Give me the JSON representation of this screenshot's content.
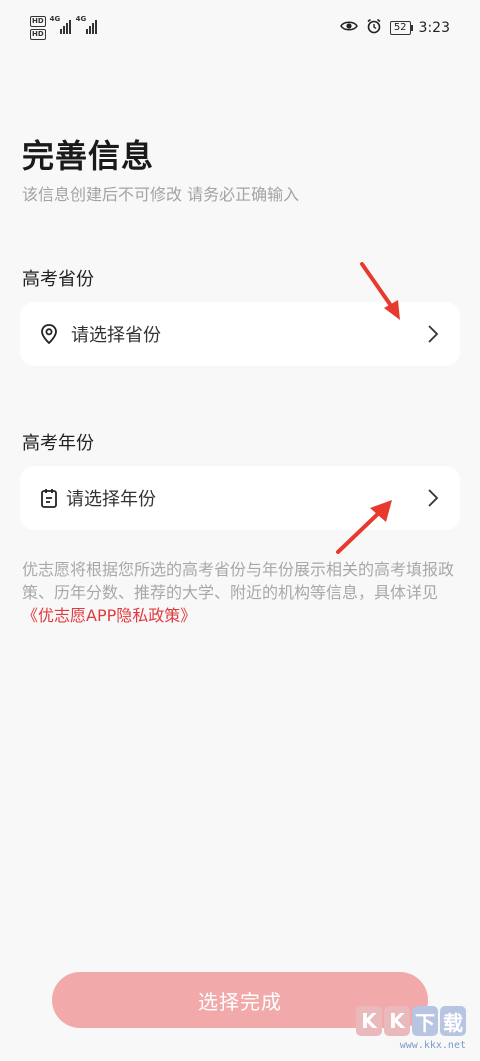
{
  "status_bar": {
    "hd1": "HD",
    "hd2": "HD",
    "net1": "4G",
    "net2": "4G",
    "battery": "52",
    "time": "3:23"
  },
  "page": {
    "title": "完善信息",
    "subtitle": "该信息创建后不可修改 请务必正确输入"
  },
  "province": {
    "label": "高考省份",
    "placeholder": "请选择省份",
    "icon": "location-pin-icon"
  },
  "year": {
    "label": "高考年份",
    "placeholder": "请选择年份",
    "icon": "calendar-clipboard-icon"
  },
  "info": {
    "text": "优志愿将根据您所选的高考省份与年份展示相关的高考填报政策、历年分数、推荐的大学、附近的机构等信息，具体详见",
    "policy_link": "《优志愿APP隐私政策》"
  },
  "finish_button": {
    "label": "选择完成"
  },
  "watermark": {
    "tiles": [
      "K",
      "K",
      "下",
      "载"
    ],
    "url": "www.kkx.net"
  },
  "colors": {
    "background": "#f8f8f8",
    "accent_red": "#e03a3e",
    "button_disabled": "#f2a9a9",
    "annotation_arrow": "#e8392f"
  }
}
